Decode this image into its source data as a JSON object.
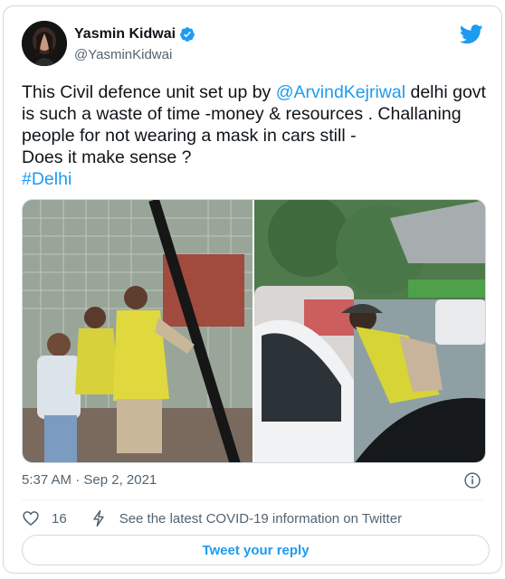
{
  "author": {
    "name": "Yasmin Kidwai",
    "handle": "@YasminKidwai",
    "verified": true
  },
  "tweet": {
    "line1_prefix": "This Civil defence unit set up by ",
    "mention": "@ArvindKejriwal",
    "line1_suffix": " delhi govt",
    "line2": "is such a waste of time -money & resources . Challaning",
    "line3": "people for not wearing a mask in cars still -",
    "line4": "Does it make sense ?",
    "hashtag": "#Delhi"
  },
  "timestamp": "5:37 AM · Sep 2, 2021",
  "actions": {
    "like_count": "16",
    "covid_info": "See the latest COVID-19 information on Twitter"
  },
  "reply_button": "Tweet your reply",
  "icons": {
    "brand": "twitter-bird-icon",
    "verified": "verified-badge-icon",
    "info": "info-icon",
    "like": "heart-icon",
    "covid": "lightning-icon"
  },
  "colors": {
    "link": "#1d9bf0",
    "text": "#0f1419",
    "secondary": "#536471",
    "border": "#cfd9de"
  }
}
